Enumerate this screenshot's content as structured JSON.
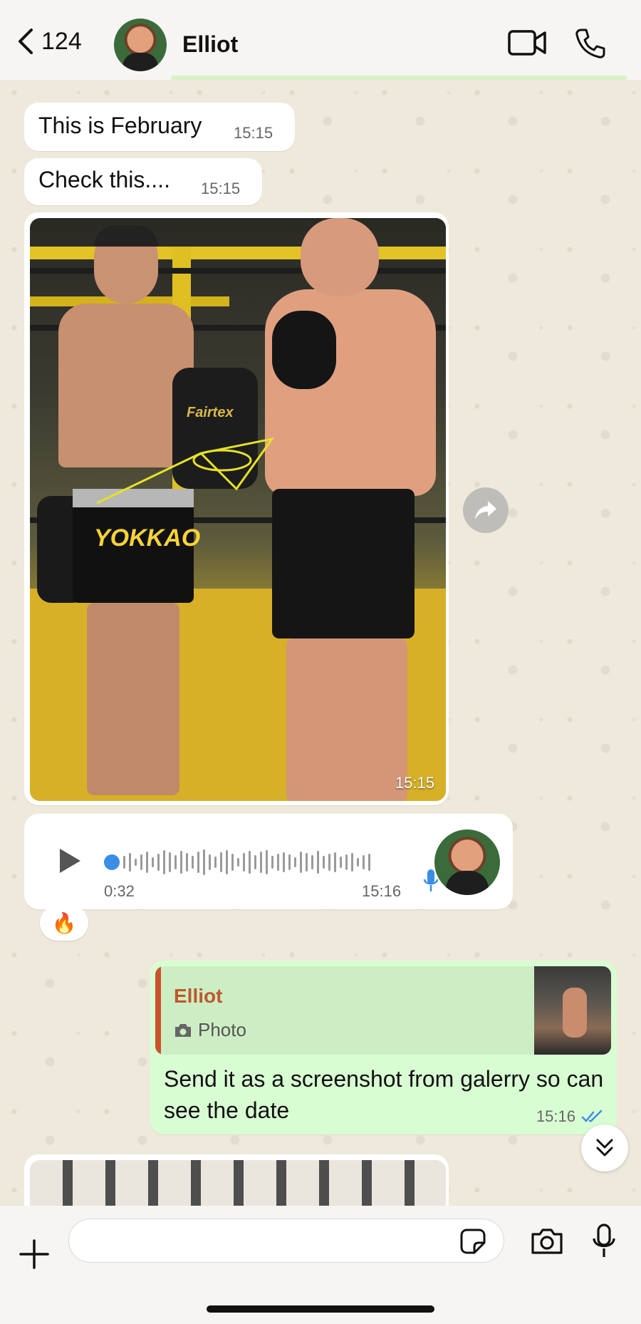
{
  "header": {
    "back_count": "124",
    "contact_name": "Elliot"
  },
  "messages": {
    "m1": {
      "text": "This is February",
      "time": "15:15"
    },
    "m2": {
      "text": "Check this....",
      "time": "15:15"
    },
    "photo": {
      "time": "15:15",
      "shorts_logo": "YOKKAO",
      "pad_logo": "Fairtex"
    },
    "voice": {
      "duration": "0:32",
      "time": "15:16",
      "reaction": "🔥"
    },
    "reply": {
      "quoted_name": "Elliot",
      "quoted_type": "Photo",
      "text": "Send it as a screenshot from galerry so can see the date",
      "time": "15:16",
      "status": "read"
    }
  },
  "composer": {
    "input_value": "",
    "placeholder": ""
  },
  "colors": {
    "outgoing_bubble": "#d9fdd3",
    "quote_accent": "#c9542a",
    "read_ticks": "#3b8de6"
  }
}
